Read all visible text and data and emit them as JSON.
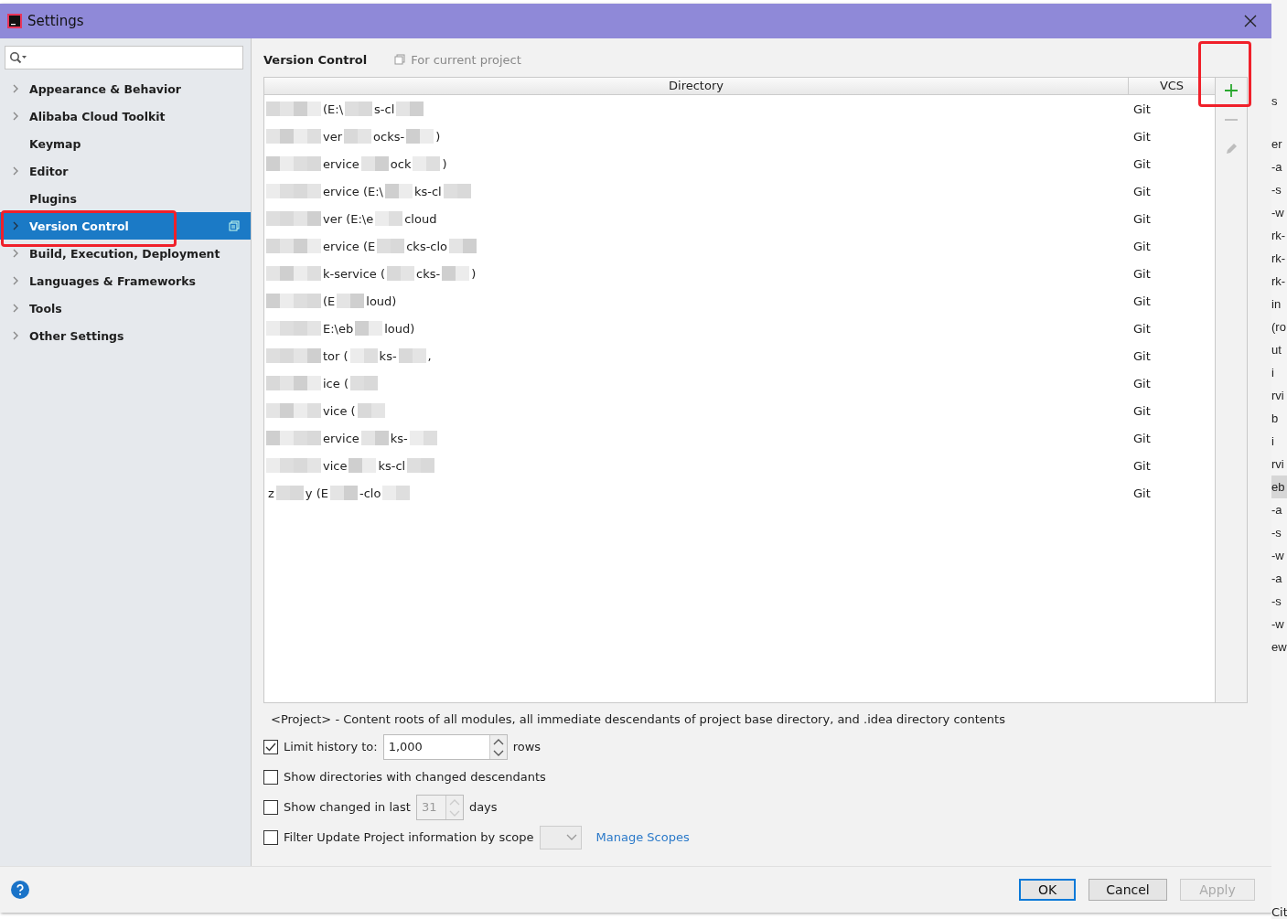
{
  "window": {
    "title": "Settings"
  },
  "sidebar": {
    "items": [
      {
        "label": "Appearance & Behavior",
        "expandable": true,
        "selected": false,
        "highlighted": false
      },
      {
        "label": "Alibaba Cloud Toolkit",
        "expandable": true,
        "selected": false,
        "highlighted": false
      },
      {
        "label": "Keymap",
        "expandable": false,
        "selected": false,
        "highlighted": false
      },
      {
        "label": "Editor",
        "expandable": true,
        "selected": false,
        "highlighted": false
      },
      {
        "label": "Plugins",
        "expandable": false,
        "selected": false,
        "highlighted": false
      },
      {
        "label": "Version Control",
        "expandable": true,
        "selected": true,
        "highlighted": true
      },
      {
        "label": "Build, Execution, Deployment",
        "expandable": true,
        "selected": false,
        "highlighted": false
      },
      {
        "label": "Languages & Frameworks",
        "expandable": true,
        "selected": false,
        "highlighted": false
      },
      {
        "label": "Tools",
        "expandable": true,
        "selected": false,
        "highlighted": false
      },
      {
        "label": "Other Settings",
        "expandable": true,
        "selected": false,
        "highlighted": false
      }
    ]
  },
  "breadcrumb": {
    "title": "Version Control",
    "scope": "For current project"
  },
  "table": {
    "columns": [
      "Directory",
      "VCS"
    ],
    "rows": [
      {
        "directory": [
          {
            "kind": "blur"
          },
          {
            "kind": "text",
            "text": "(E:\\"
          },
          {
            "kind": "blur"
          },
          {
            "kind": "text",
            "text": "s-cl"
          },
          {
            "kind": "blur"
          }
        ],
        "vcs": "Git"
      },
      {
        "directory": [
          {
            "kind": "blur"
          },
          {
            "kind": "text",
            "text": "ver"
          },
          {
            "kind": "blur"
          },
          {
            "kind": "text",
            "text": "ocks-"
          },
          {
            "kind": "blur"
          },
          {
            "kind": "text",
            "text": ")"
          }
        ],
        "vcs": "Git"
      },
      {
        "directory": [
          {
            "kind": "blur"
          },
          {
            "kind": "text",
            "text": "ervice"
          },
          {
            "kind": "blur"
          },
          {
            "kind": "text",
            "text": "ock"
          },
          {
            "kind": "blur"
          },
          {
            "kind": "text",
            "text": ")"
          }
        ],
        "vcs": "Git"
      },
      {
        "directory": [
          {
            "kind": "blur"
          },
          {
            "kind": "text",
            "text": "ervice (E:\\"
          },
          {
            "kind": "blur"
          },
          {
            "kind": "text",
            "text": "ks-cl"
          },
          {
            "kind": "blur"
          }
        ],
        "vcs": "Git"
      },
      {
        "directory": [
          {
            "kind": "blur"
          },
          {
            "kind": "text",
            "text": "ver (E:\\e"
          },
          {
            "kind": "blur"
          },
          {
            "kind": "text",
            "text": "cloud"
          }
        ],
        "vcs": "Git"
      },
      {
        "directory": [
          {
            "kind": "blur"
          },
          {
            "kind": "text",
            "text": "ervice (E"
          },
          {
            "kind": "blur"
          },
          {
            "kind": "text",
            "text": "cks-clo"
          },
          {
            "kind": "blur"
          }
        ],
        "vcs": "Git"
      },
      {
        "directory": [
          {
            "kind": "blur"
          },
          {
            "kind": "text",
            "text": "k-service ("
          },
          {
            "kind": "blur"
          },
          {
            "kind": "text",
            "text": "cks-"
          },
          {
            "kind": "blur"
          },
          {
            "kind": "text",
            "text": ")"
          }
        ],
        "vcs": "Git"
      },
      {
        "directory": [
          {
            "kind": "blur"
          },
          {
            "kind": "text",
            "text": "(E"
          },
          {
            "kind": "blur"
          },
          {
            "kind": "text",
            "text": "loud)"
          }
        ],
        "vcs": "Git"
      },
      {
        "directory": [
          {
            "kind": "blur"
          },
          {
            "kind": "text",
            "text": "E:\\eb"
          },
          {
            "kind": "blur"
          },
          {
            "kind": "text",
            "text": "loud)"
          }
        ],
        "vcs": "Git"
      },
      {
        "directory": [
          {
            "kind": "blur"
          },
          {
            "kind": "text",
            "text": "tor ("
          },
          {
            "kind": "blur"
          },
          {
            "kind": "text",
            "text": "ks-"
          },
          {
            "kind": "blur"
          },
          {
            "kind": "text",
            "text": ","
          }
        ],
        "vcs": "Git"
      },
      {
        "directory": [
          {
            "kind": "blur"
          },
          {
            "kind": "text",
            "text": "ice ("
          },
          {
            "kind": "blur"
          }
        ],
        "vcs": "Git"
      },
      {
        "directory": [
          {
            "kind": "blur"
          },
          {
            "kind": "text",
            "text": "vice ("
          },
          {
            "kind": "blur"
          }
        ],
        "vcs": "Git"
      },
      {
        "directory": [
          {
            "kind": "blur"
          },
          {
            "kind": "text",
            "text": "ervice"
          },
          {
            "kind": "blur"
          },
          {
            "kind": "text",
            "text": "ks-"
          },
          {
            "kind": "blur"
          }
        ],
        "vcs": "Git"
      },
      {
        "directory": [
          {
            "kind": "blur"
          },
          {
            "kind": "text",
            "text": "vice"
          },
          {
            "kind": "blur"
          },
          {
            "kind": "text",
            "text": "ks-cl"
          },
          {
            "kind": "blur"
          }
        ],
        "vcs": "Git"
      },
      {
        "directory": [
          {
            "kind": "text",
            "text": "z"
          },
          {
            "kind": "blur"
          },
          {
            "kind": "text",
            "text": "y (E"
          },
          {
            "kind": "blur"
          },
          {
            "kind": "text",
            "text": "-clo"
          },
          {
            "kind": "blur"
          }
        ],
        "vcs": "Git"
      }
    ]
  },
  "table_toolbar": [
    {
      "kind": "add",
      "disabled": false,
      "highlighted": true
    },
    {
      "kind": "remove",
      "disabled": true,
      "highlighted": false
    },
    {
      "kind": "edit",
      "disabled": true,
      "highlighted": false
    }
  ],
  "note": "<Project> - Content roots of all modules, all immediate descendants of project base directory, and .idea directory contents",
  "options": [
    {
      "kind": "spinner",
      "checked": true,
      "label": "Limit history to:",
      "value": "1,000",
      "suffix": "rows",
      "disabled": false
    },
    {
      "kind": "check",
      "checked": false,
      "label": "Show directories with changed descendants"
    },
    {
      "kind": "spinner",
      "checked": false,
      "label": "Show changed in last",
      "value": "31",
      "suffix": "days",
      "disabled": true
    },
    {
      "kind": "scope",
      "checked": false,
      "label": "Filter Update Project information by scope",
      "link": "Manage Scopes"
    }
  ],
  "buttons": [
    {
      "label": "OK",
      "kind": "default",
      "disabled": false
    },
    {
      "label": "Cancel",
      "kind": "normal",
      "disabled": false
    },
    {
      "label": "Apply",
      "kind": "normal",
      "disabled": true
    }
  ],
  "background_window": {
    "lines": [
      {
        "text": "s",
        "selected": false
      },
      {
        "text": "er",
        "selected": false
      },
      {
        "text": "-a",
        "selected": false
      },
      {
        "text": "-s",
        "selected": false
      },
      {
        "text": "-w",
        "selected": false
      },
      {
        "text": "rk-",
        "selected": false
      },
      {
        "text": "rk-",
        "selected": false
      },
      {
        "text": "rk-",
        "selected": false
      },
      {
        "text": "in",
        "selected": false
      },
      {
        "text": "(ro",
        "selected": false
      },
      {
        "text": "ut",
        "selected": false
      },
      {
        "text": "i",
        "selected": false
      },
      {
        "text": "rvi",
        "selected": false
      },
      {
        "text": "b",
        "selected": false
      },
      {
        "text": "i",
        "selected": false
      },
      {
        "text": "rvi",
        "selected": false
      },
      {
        "text": "eb",
        "selected": true
      },
      {
        "text": "-a",
        "selected": false
      },
      {
        "text": "-s",
        "selected": false
      },
      {
        "text": "-w",
        "selected": false
      },
      {
        "text": "-a",
        "selected": false
      },
      {
        "text": "-s",
        "selected": false
      },
      {
        "text": "-w",
        "selected": false
      },
      {
        "text": "ew",
        "selected": false
      }
    ],
    "footer": "Cit"
  }
}
